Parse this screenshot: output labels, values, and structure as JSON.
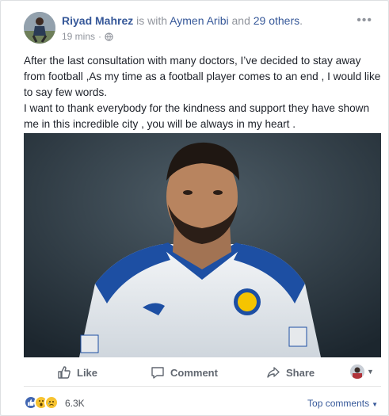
{
  "post": {
    "author": "Riyad Mahrez",
    "with_text": " is with ",
    "tagged": "Aymen Aribi",
    "and_text": " and ",
    "others": "29 others",
    "period": ".",
    "time": "19 mins",
    "dot": "·",
    "paragraph1": "After the last consultation with many doctors, I’ve decided to stay away from football ,As my time as a football player comes to an end , I would like to say few words.",
    "paragraph2": "I want to thank everybody for the kindness and support they have shown me in this incredible city , you will be always in my heart ."
  },
  "actions": {
    "like": "Like",
    "comment": "Comment",
    "share": "Share"
  },
  "reactions": {
    "count": "6.3K",
    "top_comments": "Top comments"
  },
  "colors": {
    "link": "#365899",
    "like_blue": "#4267b2",
    "wow_yellow": "#f7c331"
  }
}
